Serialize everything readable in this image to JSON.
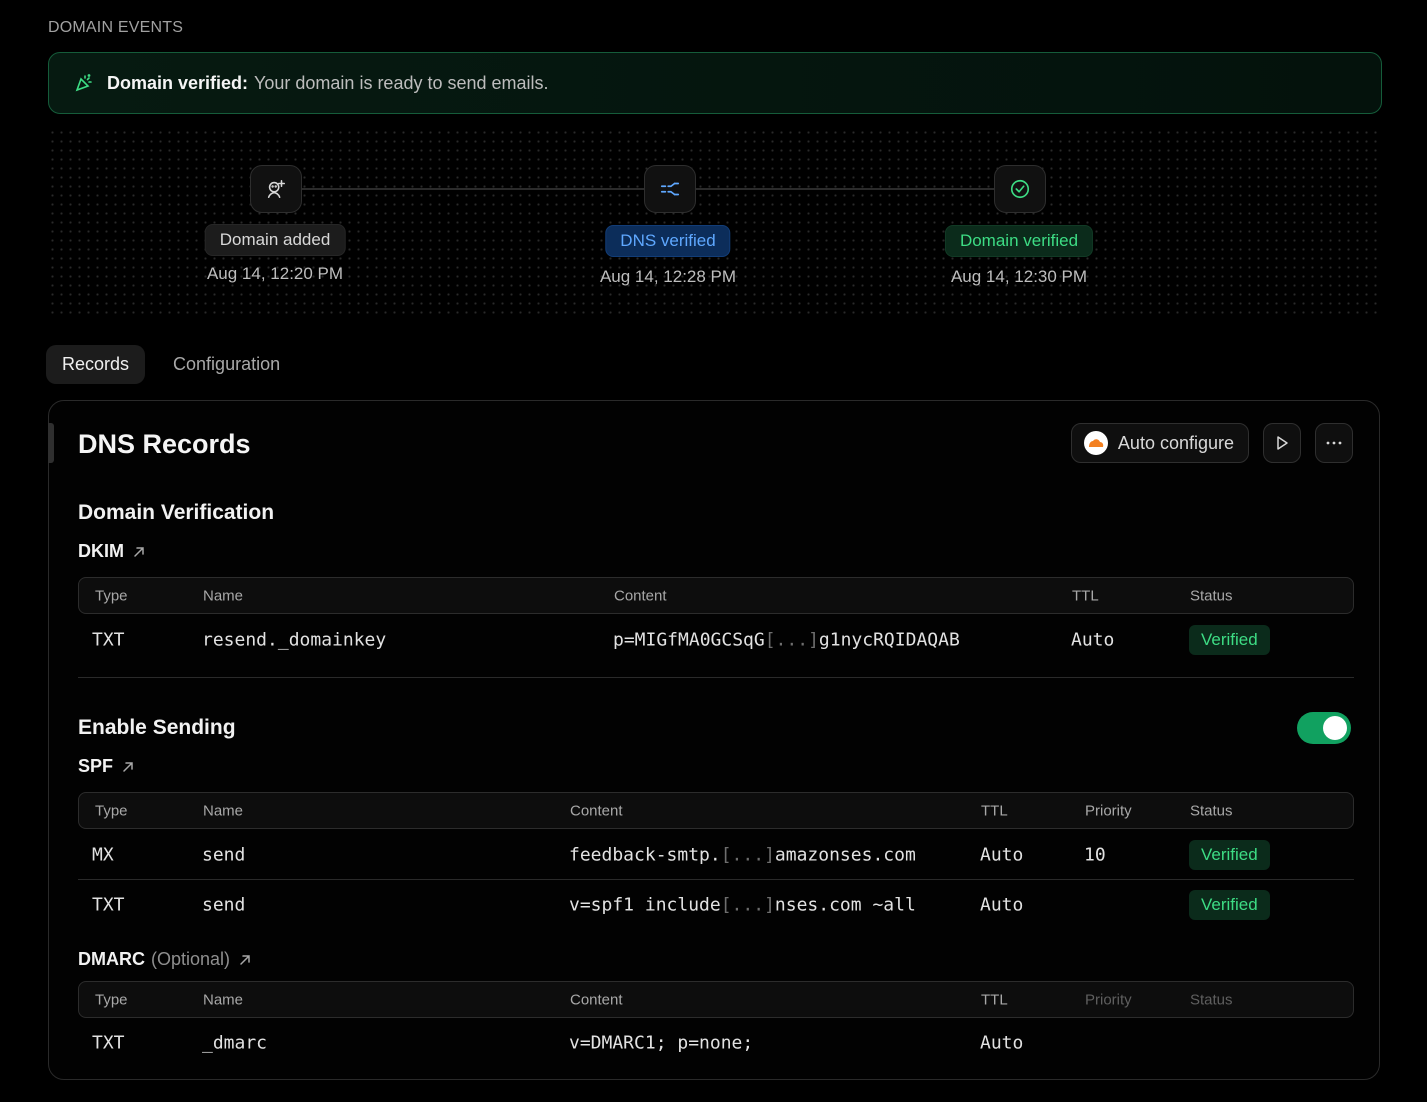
{
  "section_label": "DOMAIN EVENTS",
  "alert": {
    "title": "Domain verified:",
    "message": "Your domain is ready to send emails.",
    "color": "#3ddc84"
  },
  "timeline": [
    {
      "label": "Domain added",
      "date": "Aug 14, 12:20 PM",
      "icon": "user-plus-icon",
      "variant": "gray"
    },
    {
      "label": "DNS verified",
      "date": "Aug 14, 12:28 PM",
      "icon": "dns-compare-icon",
      "variant": "blue"
    },
    {
      "label": "Domain verified",
      "date": "Aug 14, 12:30 PM",
      "icon": "check-circle-icon",
      "variant": "green"
    }
  ],
  "tabs": [
    {
      "label": "Records",
      "active": true
    },
    {
      "label": "Configuration",
      "active": false
    }
  ],
  "card": {
    "title": "DNS Records",
    "auto_configure": "Auto configure",
    "domain_verification": {
      "heading": "Domain Verification",
      "dkim": {
        "label": "DKIM",
        "columns": [
          "Type",
          "Name",
          "Content",
          "TTL",
          "Status"
        ],
        "rows": [
          {
            "type": "TXT",
            "name": "resend._domainkey",
            "content_start": "p=MIGfMA0GCSqG",
            "content_trunc": "[...]",
            "content_end": "g1nycRQIDAQAB",
            "ttl": "Auto",
            "status": "Verified"
          }
        ]
      }
    },
    "enable_sending": {
      "heading": "Enable Sending",
      "enabled": true,
      "spf": {
        "label": "SPF",
        "columns": [
          "Type",
          "Name",
          "Content",
          "TTL",
          "Priority",
          "Status"
        ],
        "rows": [
          {
            "type": "MX",
            "name": "send",
            "content_start": "feedback-smtp.",
            "content_trunc": "[...]",
            "content_end": "amazonses.com",
            "ttl": "Auto",
            "priority": "10",
            "status": "Verified"
          },
          {
            "type": "TXT",
            "name": "send",
            "content_start": "v=spf1 include",
            "content_trunc": "[...]",
            "content_end": "nses.com ~all",
            "ttl": "Auto",
            "priority": "",
            "status": "Verified"
          }
        ]
      },
      "dmarc": {
        "label": "DMARC",
        "optional": "(Optional)",
        "columns": [
          "Type",
          "Name",
          "Content",
          "TTL",
          "Priority",
          "Status"
        ],
        "rows": [
          {
            "type": "TXT",
            "name": "_dmarc",
            "content": "v=DMARC1; p=none;",
            "ttl": "Auto"
          }
        ]
      }
    }
  }
}
